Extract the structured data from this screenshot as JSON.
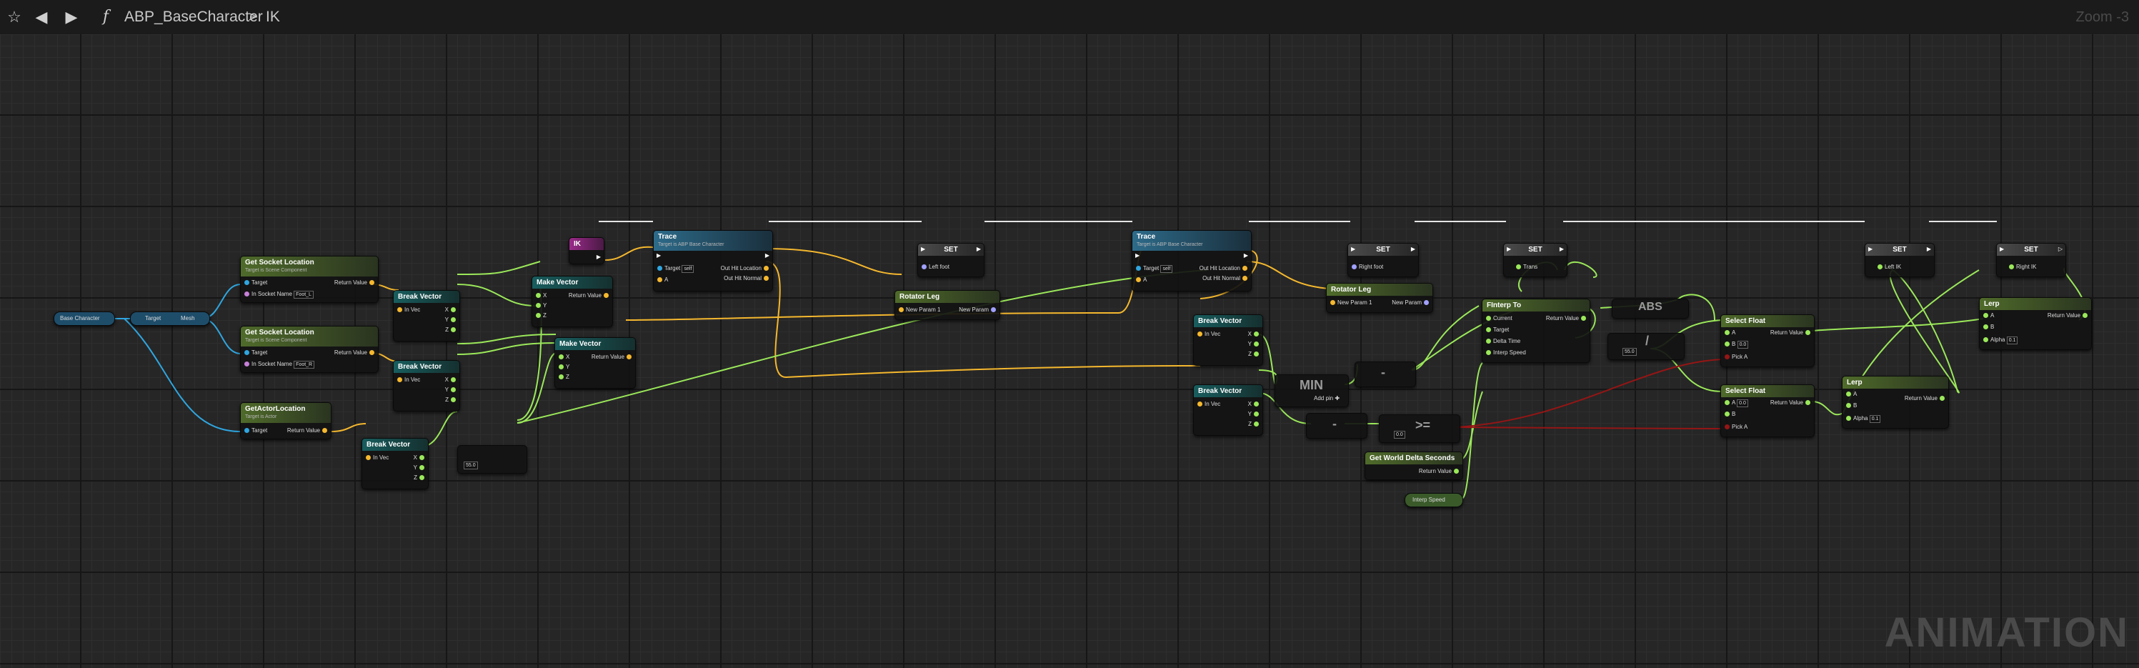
{
  "toolbar": {
    "breadcrumb_root": "ABP_BaseCharacter",
    "breadcrumb_sep": ">",
    "breadcrumb_leaf": "IK",
    "zoom": "Zoom -3",
    "function_glyph": "f"
  },
  "watermark": "ANIMATION",
  "nodes": {
    "base_character": "Base Character",
    "get_mesh": "Mesh",
    "get_mesh_target": "Target",
    "gsl1": {
      "title": "Get Socket Location",
      "sub": "Target is Scene Component",
      "target": "Target",
      "socket_name": "In Socket Name",
      "socket_value": "Foot_L",
      "ret": "Return Value"
    },
    "gsl2": {
      "title": "Get Socket Location",
      "sub": "Target is Scene Component",
      "target": "Target",
      "socket_name": "In Socket Name",
      "socket_value": "Foot_R",
      "ret": "Return Value"
    },
    "gal": {
      "title": "GetActorLocation",
      "sub": "Target is Actor",
      "target": "Target",
      "ret": "Return Value"
    },
    "bv1": {
      "title": "Break Vector",
      "in": "In Vec",
      "x": "X",
      "y": "Y",
      "z": "Z"
    },
    "bv2": {
      "title": "Break Vector",
      "in": "In Vec",
      "x": "X",
      "y": "Y",
      "z": "Z"
    },
    "bv3": {
      "title": "Break Vector",
      "in": "In Vec",
      "x": "X",
      "y": "Y",
      "z": "Z"
    },
    "bv4": {
      "title": "Break Vector",
      "in": "In Vec",
      "x": "X",
      "y": "Y",
      "z": "Z"
    },
    "bv5": {
      "title": "Break Vector",
      "in": "In Vec",
      "x": "X",
      "y": "Y",
      "z": "Z"
    },
    "mv1": {
      "title": "Make Vector",
      "ret": "Return Value",
      "x": "X",
      "y": "Y",
      "z": "Z"
    },
    "mv2": {
      "title": "Make Vector",
      "ret": "Return Value",
      "x": "X",
      "y": "Y",
      "z": "Z"
    },
    "sub1_value": "55.0",
    "ik_event": "IK",
    "trace1": {
      "title": "Trace",
      "sub": "Target is ABP Base Character",
      "target": "Target",
      "self": "self",
      "a": "A",
      "out_loc": "Out Hit Location",
      "out_norm": "Out Hit Normal"
    },
    "trace2": {
      "title": "Trace",
      "sub": "Target is ABP Base Character",
      "target": "Target",
      "self": "self",
      "a": "A",
      "out_loc": "Out Hit Location",
      "out_norm": "Out Hit Normal"
    },
    "set1": {
      "title": "SET",
      "pin": "Left foot"
    },
    "set2": {
      "title": "SET",
      "pin": "Right foot"
    },
    "set3": {
      "title": "SET",
      "pin": "Trans"
    },
    "set4": {
      "title": "SET",
      "pin": "Left IK"
    },
    "set5": {
      "title": "SET",
      "pin": "Right IK"
    },
    "rl1": {
      "title": "Rotator Leg",
      "in": "New Param 1",
      "out": "New Param"
    },
    "rl2": {
      "title": "Rotator Leg",
      "in": "New Param 1",
      "out": "New Param"
    },
    "min": {
      "title": "MIN",
      "add_pin": "Add pin"
    },
    "sub2": "-",
    "sub3": "-",
    "sub3_value": "",
    "ge": {
      "op": ">=",
      "value": "0.0"
    },
    "gwds": {
      "title": "Get World Delta Seconds",
      "ret": "Return Value"
    },
    "interp_speed": "Interp Speed",
    "finterp": {
      "title": "FInterp To",
      "current": "Current",
      "target": "Target",
      "delta": "Delta Time",
      "speed": "Interp Speed",
      "ret": "Return Value"
    },
    "abs": "ABS",
    "div": {
      "op": "/",
      "value": "55.0"
    },
    "sf1": {
      "title": "Select Float",
      "a": "A",
      "b": "B",
      "b_value": "0.0",
      "pick": "Pick A",
      "ret": "Return Value"
    },
    "sf2": {
      "title": "Select Float",
      "a": "A",
      "a_value": "0.0",
      "b": "B",
      "pick": "Pick A",
      "ret": "Return Value"
    },
    "lerp1": {
      "title": "Lerp",
      "a": "A",
      "b": "B",
      "alpha": "Alpha",
      "alpha_value": "0.1",
      "ret": "Return Value"
    },
    "lerp2": {
      "title": "Lerp",
      "a": "A",
      "b": "B",
      "alpha": "Alpha",
      "alpha_value": "0.1",
      "ret": "Return Value"
    }
  },
  "colors": {
    "exec": "#ffffff",
    "vector": "#f5b82e",
    "float": "#9be85a",
    "object": "#2fa6e0",
    "rotator": "#a0a0ff",
    "bool": "#951515",
    "name": "#c67fd8"
  }
}
